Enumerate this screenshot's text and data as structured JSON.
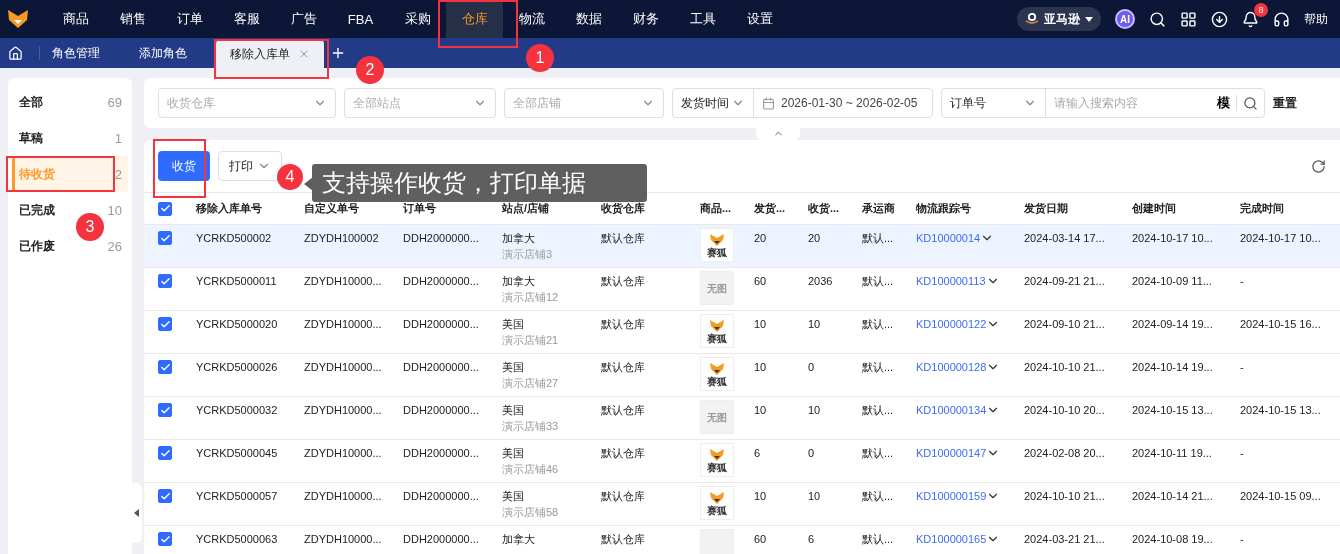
{
  "nav": {
    "items": [
      {
        "label": "商品",
        "selected": false
      },
      {
        "label": "销售",
        "selected": false
      },
      {
        "label": "订单",
        "selected": false
      },
      {
        "label": "客服",
        "selected": false
      },
      {
        "label": "广告",
        "selected": false
      },
      {
        "label": "FBA",
        "selected": false
      },
      {
        "label": "采购",
        "selected": false
      },
      {
        "label": "仓库",
        "selected": true
      },
      {
        "label": "物流",
        "selected": false
      },
      {
        "label": "数据",
        "selected": false
      },
      {
        "label": "财务",
        "selected": false
      },
      {
        "label": "工具",
        "selected": false
      },
      {
        "label": "设置",
        "selected": false
      }
    ],
    "platform": "亚马逊",
    "ai": "AI",
    "notification_count": "8",
    "help": "帮助"
  },
  "tabs": [
    {
      "label": "角色管理",
      "selected": false,
      "closable": false
    },
    {
      "label": "添加角色",
      "selected": false,
      "closable": false
    },
    {
      "label": "移除入库单",
      "selected": true,
      "closable": true
    }
  ],
  "filters": {
    "selects": [
      {
        "placeholder": "收货仓库"
      },
      {
        "placeholder": "全部站点"
      },
      {
        "placeholder": "全部店铺"
      }
    ],
    "time_type": "发货时间",
    "date_range": "2026-01-30 ~ 2026-02-05",
    "search_type": "订单号",
    "search_placeholder": "请输入搜索内容",
    "fuzzy": "模",
    "reset": "重置"
  },
  "sidebar": {
    "items": [
      {
        "label": "全部",
        "count": "69",
        "selected": false
      },
      {
        "label": "草稿",
        "count": "1",
        "selected": false
      },
      {
        "label": "待收货",
        "count": "2",
        "selected": true
      },
      {
        "label": "已完成",
        "count": "10",
        "selected": false
      },
      {
        "label": "已作废",
        "count": "26",
        "selected": false
      }
    ]
  },
  "toolbar": {
    "receive": "收货",
    "print": "打印"
  },
  "table": {
    "all_checked": true,
    "columns": [
      "移除入库单号",
      "自定义单号",
      "订单号",
      "站点/店铺",
      "收货仓库",
      "商品...",
      "发货...",
      "收货...",
      "承运商",
      "物流跟踪号",
      "发货日期",
      "创建时间",
      "完成时间"
    ],
    "rows": [
      {
        "checked": true,
        "selected": true,
        "id": "YCRKD500002",
        "custom": "ZDYDH100002",
        "order": "DDH2000000...",
        "site": "加拿大",
        "store": "演示店铺3",
        "warehouse": "默认仓库",
        "image": {
          "kind": "logo",
          "text": "赛狐"
        },
        "shipped": "20",
        "received": "20",
        "carrier": "默认...",
        "tracking": "KD10000014",
        "ship_date": "2024-03-14 17...",
        "created": "2024-10-17 10...",
        "completed": "2024-10-17 10..."
      },
      {
        "checked": true,
        "selected": false,
        "id": "YCRKD5000011",
        "custom": "ZDYDH10000...",
        "order": "DDH2000000...",
        "site": "加拿大",
        "store": "演示店铺12",
        "warehouse": "默认仓库",
        "image": {
          "kind": "none",
          "text": "无图"
        },
        "shipped": "60",
        "received": "2036",
        "carrier": "默认...",
        "tracking": "KD100000113",
        "ship_date": "2024-09-21 21...",
        "created": "2024-10-09 11...",
        "completed": "-"
      },
      {
        "checked": true,
        "selected": false,
        "id": "YCRKD5000020",
        "custom": "ZDYDH10000...",
        "order": "DDH2000000...",
        "site": "美国",
        "store": "演示店铺21",
        "warehouse": "默认仓库",
        "image": {
          "kind": "logo",
          "text": "赛狐"
        },
        "shipped": "10",
        "received": "10",
        "carrier": "默认...",
        "tracking": "KD100000122",
        "ship_date": "2024-09-10 21...",
        "created": "2024-09-14 19...",
        "completed": "2024-10-15 16..."
      },
      {
        "checked": true,
        "selected": false,
        "id": "YCRKD5000026",
        "custom": "ZDYDH10000...",
        "order": "DDH2000000...",
        "site": "美国",
        "store": "演示店铺27",
        "warehouse": "默认仓库",
        "image": {
          "kind": "logo",
          "text": "赛狐"
        },
        "shipped": "10",
        "received": "0",
        "carrier": "默认...",
        "tracking": "KD100000128",
        "ship_date": "2024-10-10 21...",
        "created": "2024-10-14 19...",
        "completed": "-"
      },
      {
        "checked": true,
        "selected": false,
        "id": "YCRKD5000032",
        "custom": "ZDYDH10000...",
        "order": "DDH2000000...",
        "site": "美国",
        "store": "演示店铺33",
        "warehouse": "默认仓库",
        "image": {
          "kind": "none",
          "text": "无图"
        },
        "shipped": "10",
        "received": "10",
        "carrier": "默认...",
        "tracking": "KD100000134",
        "ship_date": "2024-10-10 20...",
        "created": "2024-10-15 13...",
        "completed": "2024-10-15 13..."
      },
      {
        "checked": true,
        "selected": false,
        "id": "YCRKD5000045",
        "custom": "ZDYDH10000...",
        "order": "DDH2000000...",
        "site": "美国",
        "store": "演示店铺46",
        "warehouse": "默认仓库",
        "image": {
          "kind": "logo",
          "text": "赛狐"
        },
        "shipped": "6",
        "received": "0",
        "carrier": "默认...",
        "tracking": "KD100000147",
        "ship_date": "2024-02-08 20...",
        "created": "2024-10-11 19...",
        "completed": "-"
      },
      {
        "checked": true,
        "selected": false,
        "id": "YCRKD5000057",
        "custom": "ZDYDH10000...",
        "order": "DDH2000000...",
        "site": "美国",
        "store": "演示店铺58",
        "warehouse": "默认仓库",
        "image": {
          "kind": "logo",
          "text": "赛狐"
        },
        "shipped": "10",
        "received": "10",
        "carrier": "默认...",
        "tracking": "KD100000159",
        "ship_date": "2024-10-10 21...",
        "created": "2024-10-14 21...",
        "completed": "2024-10-15 09..."
      },
      {
        "checked": true,
        "selected": false,
        "id": "YCRKD5000063",
        "custom": "ZDYDH10000...",
        "order": "DDH2000000...",
        "site": "加拿大",
        "warehouse": "默认仓库",
        "image": {
          "kind": "none"
        },
        "shipped": "60",
        "received": "6",
        "carrier": "默认...",
        "tracking": "KD100000165",
        "ship_date": "2024-03-21 21...",
        "created": "2024-10-08 19...",
        "completed": "-"
      }
    ]
  },
  "annotations": {
    "markers": [
      "1",
      "2",
      "3",
      "4"
    ],
    "tooltip": "支持操作收货，打印单据"
  }
}
